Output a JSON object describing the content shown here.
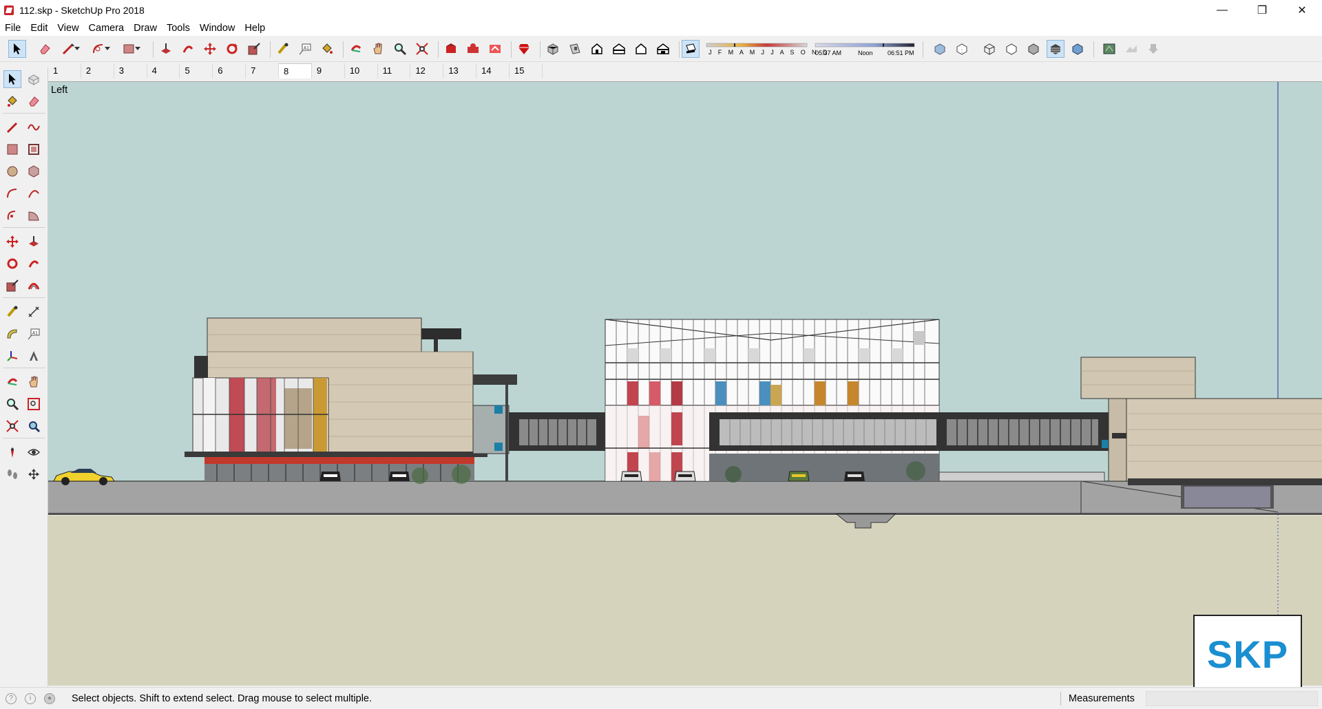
{
  "window": {
    "title": "112.skp - SketchUp Pro 2018",
    "controls": [
      "minimize",
      "restore",
      "close"
    ]
  },
  "menu": {
    "items": [
      "File",
      "Edit",
      "View",
      "Camera",
      "Draw",
      "Tools",
      "Window",
      "Help"
    ]
  },
  "toolbar": {
    "shadow_months": "J F M A M J J A S O N D",
    "shadow_time_start": "05:37 AM",
    "shadow_time_mid": "Noon",
    "shadow_time_end": "06:51 PM"
  },
  "scenes": {
    "tabs": [
      "1",
      "2",
      "3",
      "4",
      "5",
      "6",
      "7",
      "8",
      "9",
      "10",
      "11",
      "12",
      "13",
      "14",
      "15"
    ],
    "active": "8"
  },
  "viewport": {
    "view_name": "Left",
    "sky_color": "#bcd5d3",
    "ground_color": "#d6d3bd"
  },
  "status": {
    "hint": "Select objects. Shift to extend select. Drag mouse to select multiple.",
    "measurements_label": "Measurements",
    "measurements_value": ""
  },
  "logo": {
    "text": "SKP"
  }
}
